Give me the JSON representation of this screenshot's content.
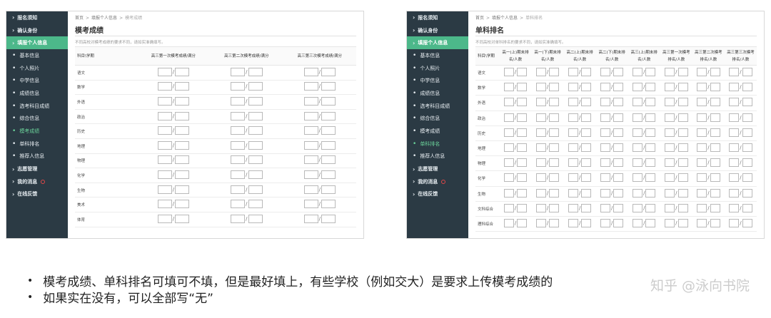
{
  "left_panel": {
    "sidebar": [
      {
        "type": "top",
        "label": "报名须知"
      },
      {
        "type": "top",
        "label": "确认身份"
      },
      {
        "type": "active",
        "label": "填报个人信息"
      },
      {
        "type": "sub",
        "label": "基本信息"
      },
      {
        "type": "sub",
        "label": "个人照片"
      },
      {
        "type": "sub",
        "label": "中学信息"
      },
      {
        "type": "sub",
        "label": "成绩信息"
      },
      {
        "type": "sub",
        "label": "选考科目成绩"
      },
      {
        "type": "sub",
        "label": "综合信息"
      },
      {
        "type": "subhl",
        "label": "模考成绩"
      },
      {
        "type": "sub",
        "label": "单科排名"
      },
      {
        "type": "sub",
        "label": "推荐人信息"
      },
      {
        "type": "top",
        "label": "志愿管理"
      },
      {
        "type": "topbadge",
        "label": "我的消息"
      },
      {
        "type": "top",
        "label": "在线反馈"
      }
    ],
    "breadcrumb": [
      "首页",
      "填报个人信息",
      "模考成绩"
    ],
    "title": "模考成绩",
    "note": "不同高校对模考成绩的要求不同，请如实准确填写。",
    "columns": [
      "科目\\学期",
      "高三第一次模考成绩/满分",
      "高三第二次模考成绩/满分",
      "高三第三次模考成绩/满分"
    ],
    "rows": [
      "语文",
      "数学",
      "外语",
      "政治",
      "历史",
      "地理",
      "物理",
      "化学",
      "生物",
      "美术",
      "体育"
    ]
  },
  "right_panel": {
    "sidebar": [
      {
        "type": "top",
        "label": "报名须知"
      },
      {
        "type": "top",
        "label": "确认身份"
      },
      {
        "type": "active",
        "label": "填报个人信息"
      },
      {
        "type": "sub",
        "label": "基本信息"
      },
      {
        "type": "sub",
        "label": "个人照片"
      },
      {
        "type": "sub",
        "label": "中学信息"
      },
      {
        "type": "sub",
        "label": "成绩信息"
      },
      {
        "type": "sub",
        "label": "选考科目成绩"
      },
      {
        "type": "sub",
        "label": "综合信息"
      },
      {
        "type": "sub",
        "label": "模考成绩"
      },
      {
        "type": "subhl",
        "label": "单科排名"
      },
      {
        "type": "sub",
        "label": "推荐人信息"
      },
      {
        "type": "top",
        "label": "志愿管理"
      },
      {
        "type": "topbadge",
        "label": "我的消息"
      },
      {
        "type": "top",
        "label": "在线反馈"
      }
    ],
    "breadcrumb": [
      "首页",
      "填报个人信息",
      "单科排名"
    ],
    "title": "单科排名",
    "note": "不同高校对单科排名的要求不同，请如实准确填写。",
    "columns": [
      "科目\\学期",
      "高一(上)期末排名/人数",
      "高一(下)期末排名/人数",
      "高二(上)期末排名/人数",
      "高二(下)期末排名/人数",
      "高三(上)期末排名/人数",
      "高三第一次模考排名/人数",
      "高三第二次模考排名/人数",
      "高三第三次模考排名/人数"
    ],
    "rows": [
      "语文",
      "数学",
      "外语",
      "政治",
      "历史",
      "地理",
      "物理",
      "化学",
      "生物",
      "文科综合",
      "理科综合"
    ]
  },
  "bullets": [
    "模考成绩、单科排名可填可不填，但是最好填上，有些学校（例如交大）是要求上传模考成绩的",
    "如果实在没有，可以全部写“无”"
  ],
  "watermark": "知乎 @泳向书院"
}
